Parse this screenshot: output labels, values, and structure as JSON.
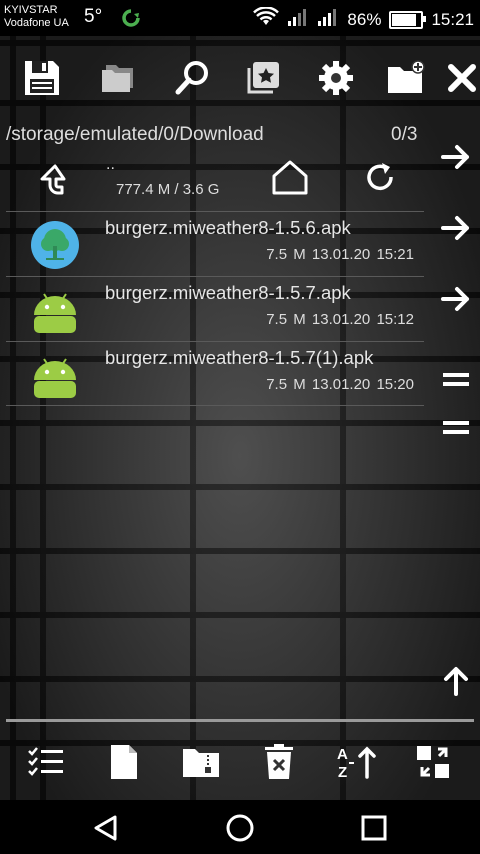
{
  "status": {
    "carrier1": "KYIVSTAR",
    "carrier2": "Vodafone UA",
    "temperature": "5°",
    "battery": "86%",
    "battery_level": 0.86,
    "time": "15:21"
  },
  "toolbar": {
    "icons": [
      "save-icon",
      "folders-icon",
      "search-icon",
      "bookmark-icon",
      "settings-icon",
      "new-folder-icon",
      "close-icon"
    ]
  },
  "location": {
    "path": "/storage/emulated/0/Download",
    "selection_count": "0/3"
  },
  "parent": {
    "dots": "..",
    "storage": "777.4 M / 3.6 G"
  },
  "files": [
    {
      "name": "burgerz.miweather8-1.5.6.apk",
      "size": "7.5 M",
      "date": "13.01.20",
      "time": "15:21",
      "icon": "tree-app-icon"
    },
    {
      "name": "burgerz.miweather8-1.5.7.apk",
      "size": "7.5 M",
      "date": "13.01.20",
      "time": "15:12",
      "icon": "android-icon"
    },
    {
      "name": "burgerz.miweather8-1.5.7(1).apk",
      "size": "7.5 M",
      "date": "13.01.20",
      "time": "15:20",
      "icon": "android-icon"
    }
  ],
  "bottombar": {
    "icons": [
      "select-list-icon",
      "new-file-icon",
      "archive-icon",
      "delete-icon",
      "sort-az-icon",
      "swap-panels-icon"
    ]
  },
  "colors": {
    "android_green": "#9ccc45",
    "tree_blue": "#4fb3e8"
  }
}
